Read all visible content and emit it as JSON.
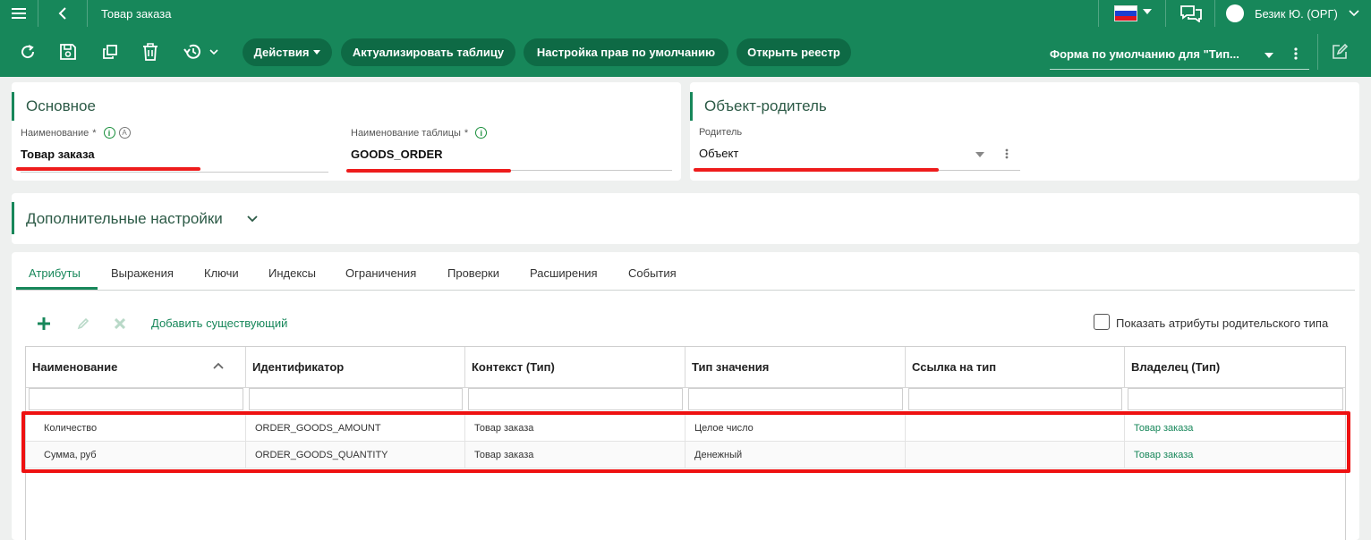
{
  "topbar": {
    "title": "Товар заказа",
    "user": "Безик Ю. (ОРГ)",
    "colors": {
      "primary": "#17875a",
      "primary_dark": "#0e6a45",
      "highlight": "#ee1111"
    }
  },
  "toolbar": {
    "actions_label": "Действия",
    "refresh_table_label": "Актуализировать таблицу",
    "default_rights_label": "Настройка прав по умолчанию",
    "open_registry_label": "Открыть реестр",
    "form_select_value": "Форма по умолчанию для \"Тип..."
  },
  "main_card": {
    "title": "Основное",
    "name_label": "Наименование",
    "name_value": "Товар заказа",
    "table_label": "Наименование таблицы",
    "table_value": "GOODS_ORDER",
    "required_mark": "*",
    "info_glyph": "i",
    "a_glyph": "A"
  },
  "parent_card": {
    "title": "Объект-родитель",
    "parent_label": "Родитель",
    "parent_value": "Объект"
  },
  "extra_card": {
    "title": "Дополнительные настройки"
  },
  "tabs": [
    "Атрибуты",
    "Выражения",
    "Ключи",
    "Индексы",
    "Ограничения",
    "Проверки",
    "Расширения",
    "События"
  ],
  "attributes": {
    "add_existing_label": "Добавить существующий",
    "show_parent_label": "Показать атрибуты родительского типа",
    "show_parent_checked": false,
    "columns": [
      "Наименование",
      "Идентификатор",
      "Контекст (Тип)",
      "Тип значения",
      "Ссылка на тип",
      "Владелец (Тип)"
    ],
    "sort": {
      "column": "Наименование",
      "direction": "ascending"
    },
    "rows": [
      [
        "Количество",
        "ORDER_GOODS_AMOUNT",
        "Товар заказа",
        "Целое число",
        "",
        "Товар заказа"
      ],
      [
        "Сумма, руб",
        "ORDER_GOODS_QUANTITY",
        "Товар заказа",
        "Денежный",
        "",
        "Товар заказа"
      ]
    ]
  }
}
